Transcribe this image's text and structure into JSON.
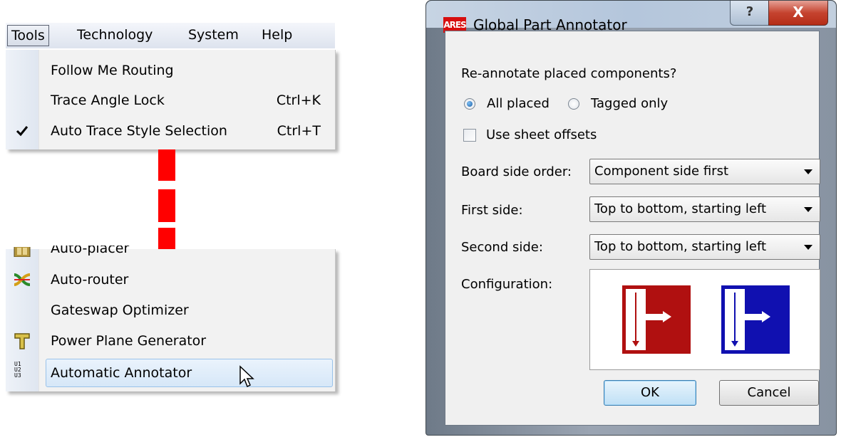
{
  "menubar": {
    "items": [
      "Tools",
      "Technology",
      "System",
      "Help"
    ]
  },
  "tools_menu": {
    "top_items": [
      {
        "label": "Follow Me Routing",
        "shortcut": ""
      },
      {
        "label": "Trace Angle Lock",
        "shortcut": "Ctrl+K"
      },
      {
        "label": "Auto Trace Style Selection",
        "shortcut": "Ctrl+T",
        "checked": true
      }
    ],
    "bottom_items": [
      {
        "label": "Auto-placer",
        "icon": "auto-placer-icon"
      },
      {
        "label": "Auto-router",
        "icon": "auto-router-icon"
      },
      {
        "label": "Gateswap Optimizer",
        "icon": ""
      },
      {
        "label": "Power Plane Generator",
        "icon": "power-plane-icon"
      },
      {
        "label": "Automatic Annotator",
        "icon": "annotator-icon",
        "highlighted": true
      }
    ],
    "annotator_icon_text": "U1\nU2\nU3"
  },
  "dialog": {
    "app_icon_text": "ARES",
    "title": "Global Part Annotator",
    "help_button": "?",
    "close_button": "X",
    "question": "Re-annotate placed components?",
    "radio_all": "All placed",
    "radio_tagged": "Tagged only",
    "radio_selected": "all",
    "sheet_offsets_label": "Use sheet offsets",
    "sheet_offsets_checked": false,
    "board_side_order_label": "Board side order:",
    "board_side_order_value": "Component side first",
    "first_side_label": "First side:",
    "first_side_value": "Top to bottom, starting left",
    "second_side_label": "Second side:",
    "second_side_value": "Top to bottom, starting left",
    "configuration_label": "Configuration:",
    "ok_label": "OK",
    "cancel_label": "Cancel"
  },
  "colors": {
    "break_dash": "#ff0000",
    "config_first_side": "#b01010",
    "config_second_side": "#1010b0",
    "close_button": "#c5432f"
  }
}
